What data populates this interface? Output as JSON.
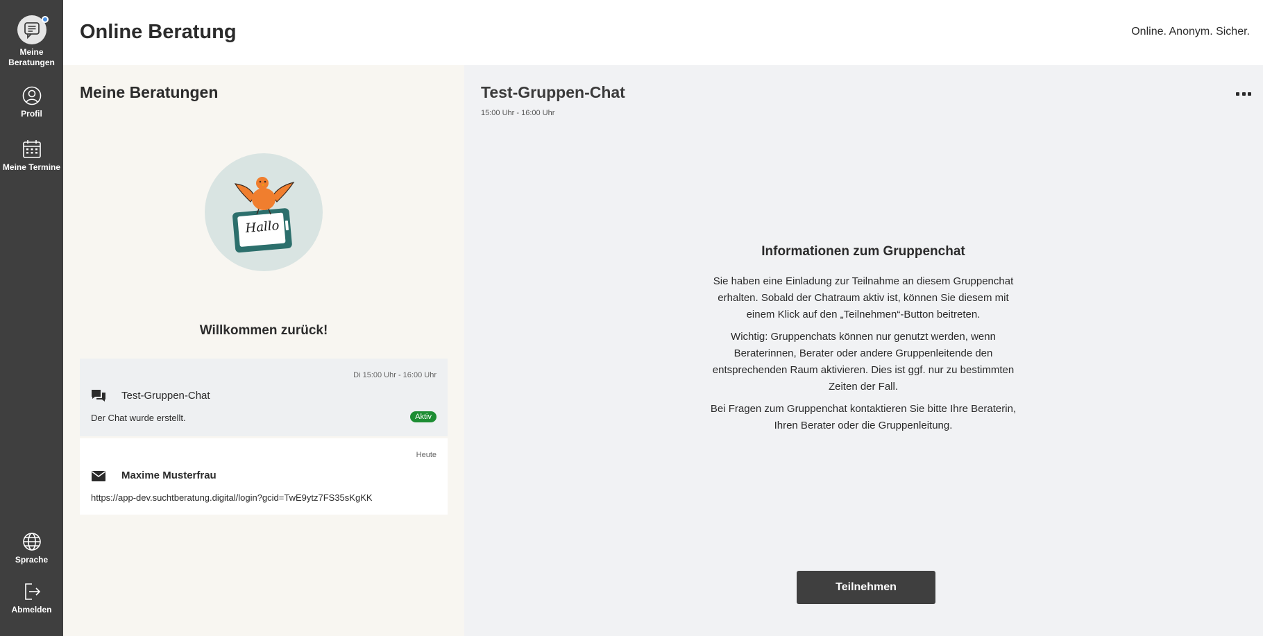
{
  "nav": {
    "items_top": [
      {
        "label_line1": "Meine",
        "label_line2": "Beratungen",
        "icon": "speech-bubble-icon"
      },
      {
        "label": "Profil",
        "icon": "user-icon"
      },
      {
        "label": "Meine Termine",
        "icon": "calendar-icon"
      }
    ],
    "items_bottom": [
      {
        "label": "Sprache",
        "icon": "globe-icon"
      },
      {
        "label": "Abmelden",
        "icon": "logout-icon"
      }
    ]
  },
  "header": {
    "title": "Online Beratung",
    "claim": "Online. Anonym. Sicher."
  },
  "session_list": {
    "title": "Meine Beratungen",
    "welcome_text": "Willkommen zurück!",
    "illustration_text": "Hallo",
    "items": [
      {
        "date": "Di 15:00 Uhr - 16:00 Uhr",
        "name": "Test-Gruppen-Chat",
        "last_message": "Der Chat wurde erstellt.",
        "badge": "Aktiv",
        "icon": "group-chat-icon"
      },
      {
        "date": "Heute",
        "name": "Maxime Musterfrau",
        "last_message": "https://app-dev.suchtberatung.digital/login?gcid=TwE9ytz7FS35sKgKK",
        "icon": "envelope-icon"
      }
    ]
  },
  "main": {
    "chat_title": "Test-Gruppen-Chat",
    "chat_time": "15:00 Uhr - 16:00 Uhr",
    "info_title": "Informationen zum Gruppenchat",
    "info_p1": "Sie haben eine Einladung zur Teilnahme an diesem Gruppenchat erhalten. Sobald der Chatraum aktiv ist, können Sie diesem mit einem Klick auf den „Teilnehmen“-Button beitreten.",
    "info_p2": "Wichtig: Gruppenchats können nur genutzt werden, wenn Beraterinnen, Berater oder andere Gruppenleitende den entsprechenden Raum aktivieren. Dies ist ggf. nur zu bestimmten Zeiten der Fall.",
    "info_p3": "Bei Fragen zum Gruppenchat kontaktieren Sie bitte Ihre Beraterin, Ihren Berater oder die Gruppenleitung.",
    "join_button": "Teilnehmen"
  },
  "colors": {
    "nav_bg": "#3f3f3f",
    "list_bg": "#f8f6f1",
    "main_bg": "#f1f2f4",
    "badge_green": "#1d8d33",
    "bird_orange": "#f07e2e"
  }
}
